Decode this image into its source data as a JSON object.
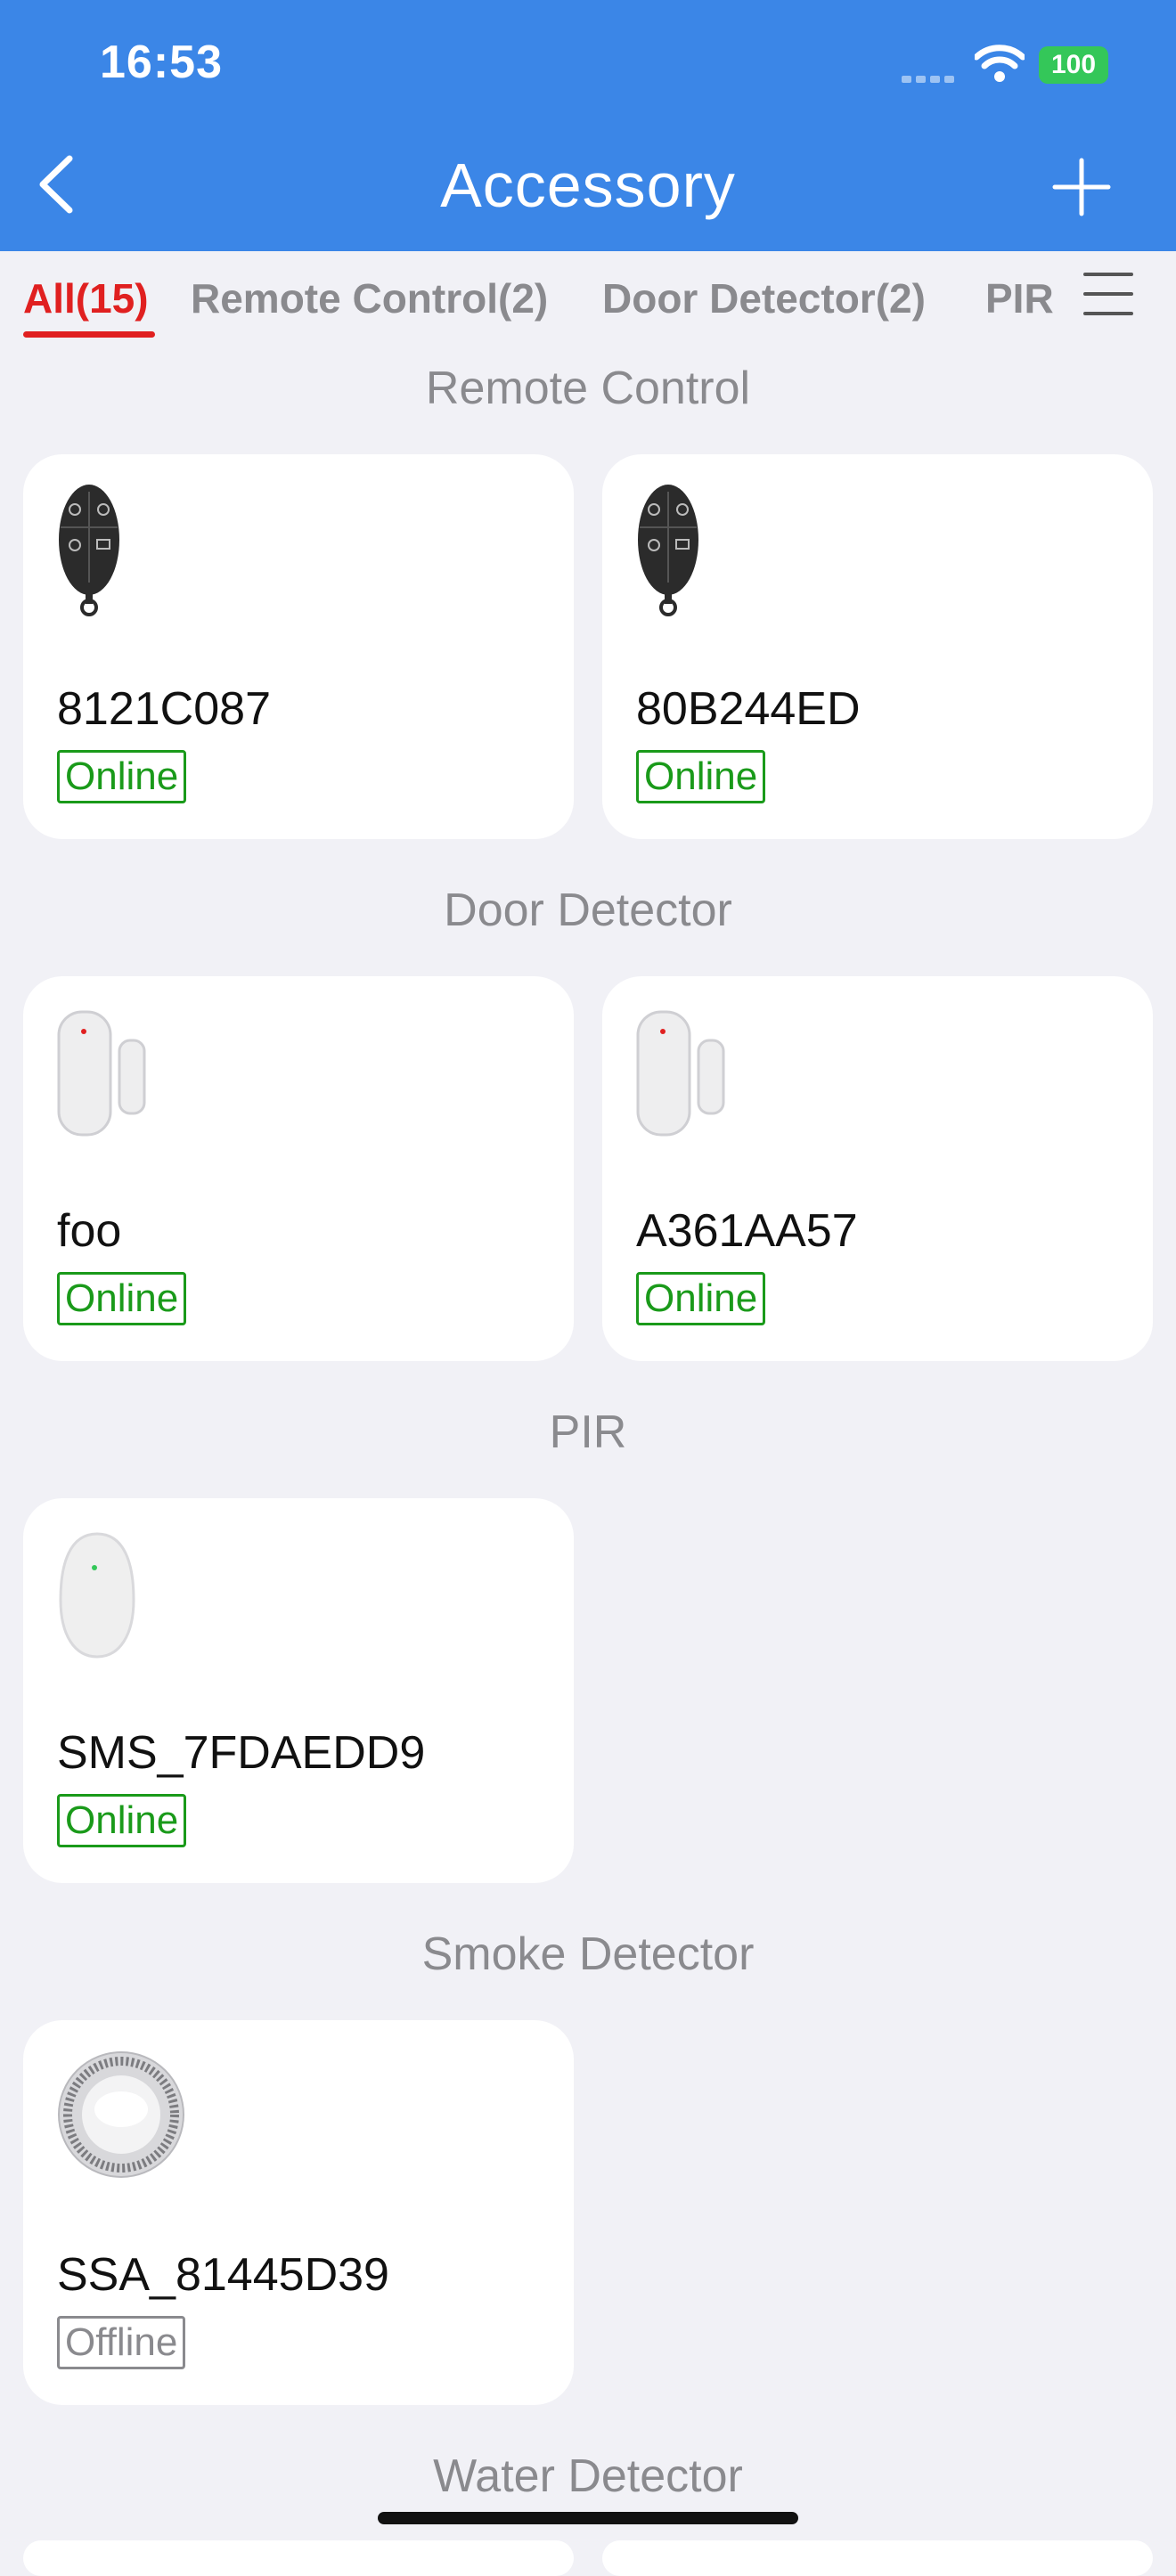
{
  "status_bar": {
    "time": "16:53",
    "battery": "100"
  },
  "header": {
    "title": "Accessory"
  },
  "tabs": [
    {
      "label": "All(15)"
    },
    {
      "label": "Remote Control(2)"
    },
    {
      "label": "Door Detector(2)"
    },
    {
      "label": "PIR"
    }
  ],
  "sections": {
    "remote": {
      "title": "Remote Control",
      "items": [
        {
          "name": "8121C087",
          "status": "Online"
        },
        {
          "name": "80B244ED",
          "status": "Online"
        }
      ]
    },
    "door": {
      "title": "Door Detector",
      "items": [
        {
          "name": "foo",
          "status": "Online"
        },
        {
          "name": "A361AA57",
          "status": "Online"
        }
      ]
    },
    "pir": {
      "title": "PIR",
      "items": [
        {
          "name": "SMS_7FDAEDD9",
          "status": "Online"
        }
      ]
    },
    "smoke": {
      "title": "Smoke Detector",
      "items": [
        {
          "name": "SSA_81445D39",
          "status": "Offline"
        }
      ]
    },
    "water": {
      "title": "Water Detector"
    }
  },
  "colors": {
    "header_bg": "#3b86e7",
    "accent_active": "#e02020",
    "online": "#1a9a1a",
    "offline": "#8a8a8e"
  }
}
